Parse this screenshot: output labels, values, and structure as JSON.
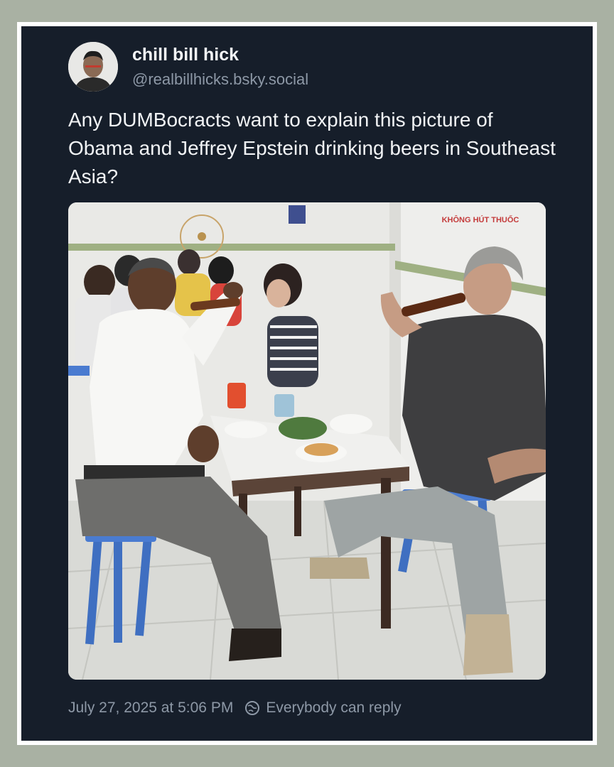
{
  "post": {
    "author": {
      "display_name": "chill bill hick",
      "handle": "@realbillhicks.bsky.social"
    },
    "text": "Any DUMBocracts want to explain this picture of Obama and Jeffrey Epstein drinking beers in Southeast Asia?",
    "image": {
      "wall_sign_text": "KHÔNG HÚT THUỐC"
    },
    "timestamp": "July 27, 2025 at 5:06 PM",
    "reply_setting": "Everybody can reply"
  },
  "icons": {
    "reply_setting_icon": "globe-icon"
  },
  "colors": {
    "card_background": "#161e2a",
    "page_background": "#a9b1a3",
    "secondary_text": "#8d98a6",
    "primary_text": "#f1f3f5"
  }
}
